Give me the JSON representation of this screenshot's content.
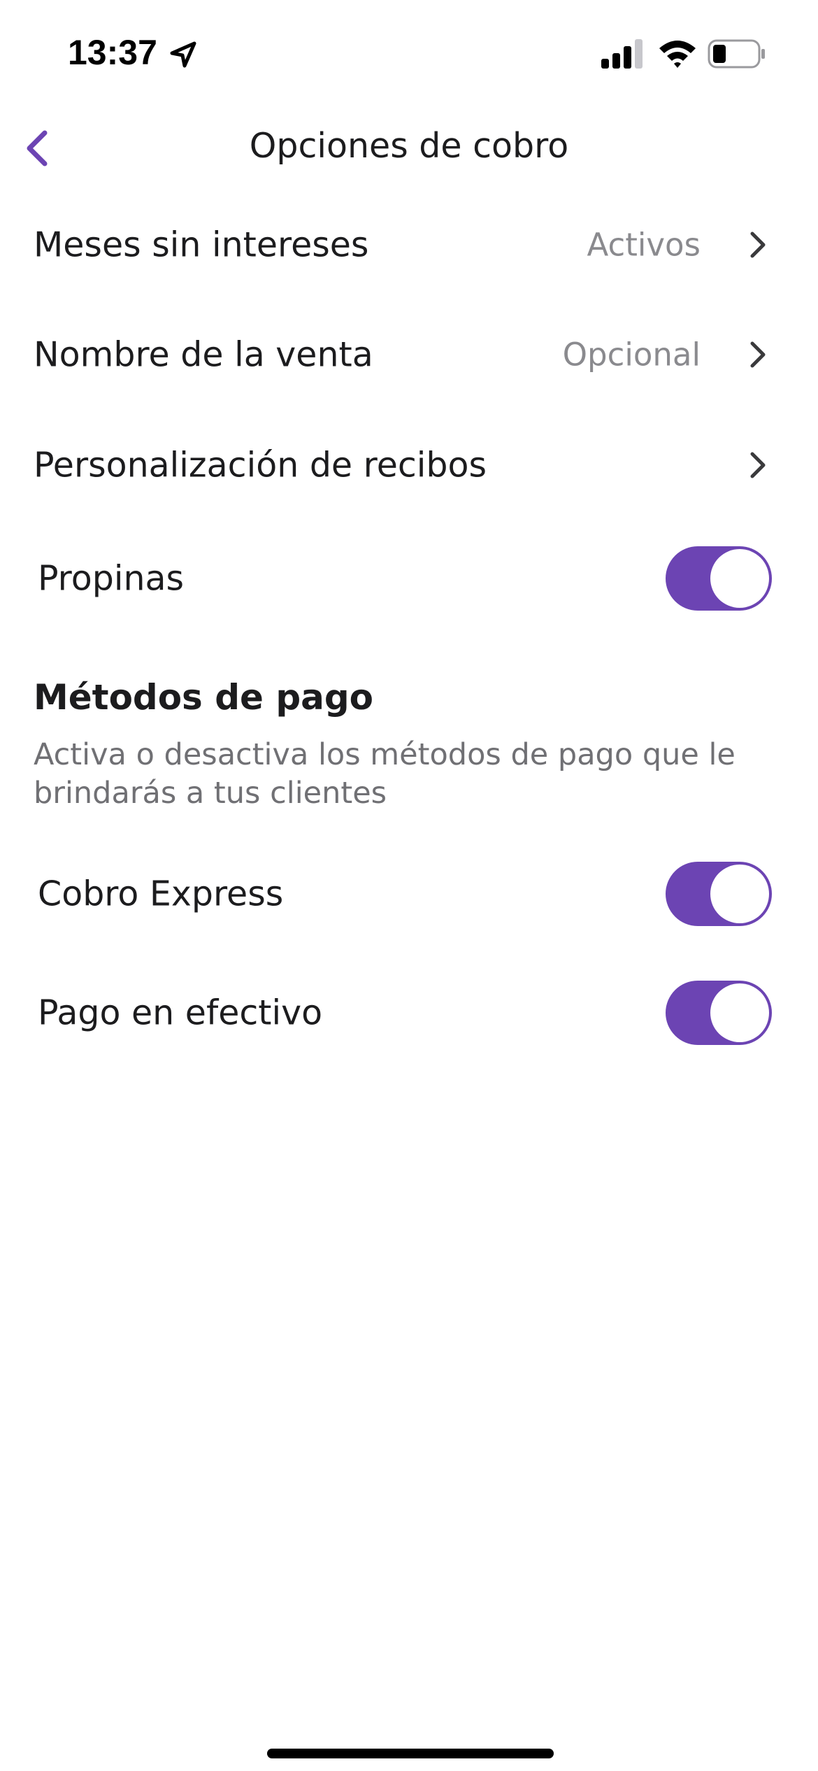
{
  "status_bar": {
    "time": "13:37"
  },
  "header": {
    "title": "Opciones de cobro"
  },
  "settings_rows": [
    {
      "label": "Meses sin intereses",
      "value": "Activos"
    },
    {
      "label": "Nombre de la venta",
      "value": "Opcional"
    },
    {
      "label": "Personalización de recibos",
      "value": ""
    }
  ],
  "propinas": {
    "label": "Propinas",
    "enabled": true
  },
  "payment_methods": {
    "title": "Métodos de pago",
    "description": "Activa o desactiva los métodos de pago que le brindarás a tus clientes",
    "items": [
      {
        "label": "Cobro Express",
        "enabled": true
      },
      {
        "label": "Pago en efectivo",
        "enabled": true
      }
    ]
  },
  "colors": {
    "accent": "#6c44b3",
    "text_primary": "#1c1c1e",
    "text_secondary": "#8a8a8e"
  },
  "icons": [
    "location-arrow-icon",
    "signal-icon",
    "wifi-icon",
    "battery-icon",
    "chevron-left-icon",
    "chevron-right-icon"
  ]
}
